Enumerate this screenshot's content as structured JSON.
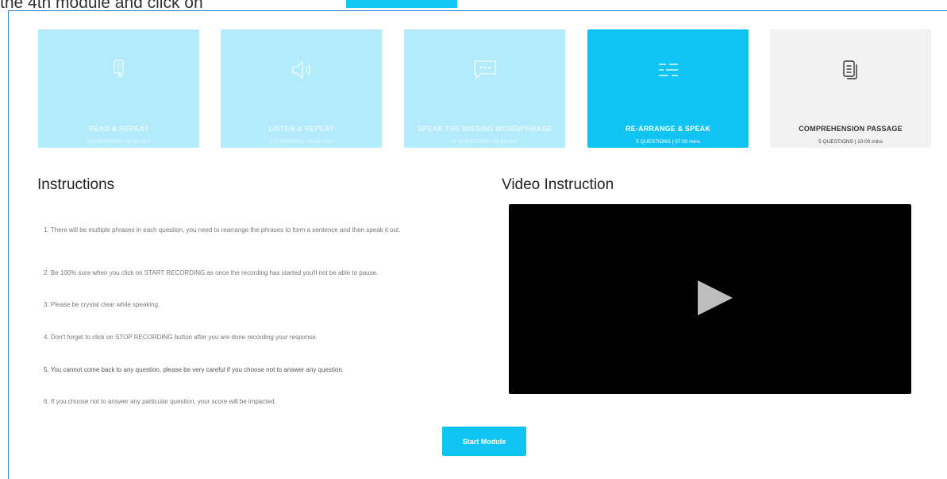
{
  "caption": {
    "text": "the 4th module and click on"
  },
  "modules": [
    {
      "title": "READ & REPEAT",
      "meta": "6 QUESTIONS | 02:30 mins",
      "icon": "document-tap-icon",
      "state": "faded"
    },
    {
      "title": "LISTEN & REPEAT",
      "meta": "5 QUESTIONS | 02:30 mins",
      "icon": "speaker-icon",
      "state": "faded"
    },
    {
      "title": "SPEAK THE MISSING WORD/PHRASE",
      "meta": "11 QUESTIONS | 06:30 mins",
      "icon": "chat-bubble-icon",
      "state": "faded"
    },
    {
      "title": "RE-ARRANGE & SPEAK",
      "meta": "5 QUESTIONS | 07:00 mins",
      "icon": "rearrange-lines-icon",
      "state": "active"
    },
    {
      "title": "COMPREHENSION PASSAGE",
      "meta": "5 QUESTIONS | 10:00 mins",
      "icon": "documents-icon",
      "state": "inactive"
    }
  ],
  "instructions": {
    "heading": "Instructions",
    "items": [
      "1. There will be multiple phrases in each question, you need to rearrange the phrases to form a sentence and then speak it out.",
      "2. Be 100% sure when you click on START RECORDING as once the recording has started you'll not be able to pause.",
      "3. Please be crystal clear while speaking.",
      "4. Don't forget to click on STOP RECORDING button after you are done recording your response.",
      "5. You cannot come back to any question, please be very careful if you choose not to answer any question.",
      "6. If you choose not to answer any particular question, your score will be impacted."
    ]
  },
  "video": {
    "heading": "Video Instruction"
  },
  "start_button": {
    "label": "Start Module"
  },
  "colors": {
    "accent": "#0fc4f2",
    "faded": "#b3ebfb",
    "inactive": "#f2f2f2",
    "frame": "#2c7fc9"
  }
}
